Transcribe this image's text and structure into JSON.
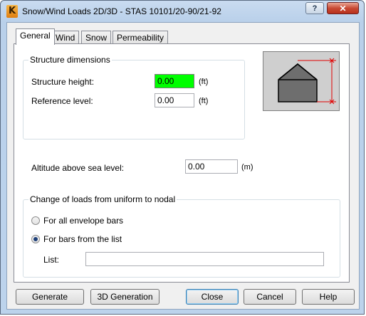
{
  "window": {
    "title": "Snow/Wind Loads 2D/3D - STAS 10101/20-90/21-92",
    "app_icon_letter": "K",
    "help_label": "?",
    "close_label": "✕"
  },
  "tabs": [
    {
      "label": "General",
      "active": true
    },
    {
      "label": "Wind",
      "active": false
    },
    {
      "label": "Snow",
      "active": false
    },
    {
      "label": "Permeability",
      "active": false
    }
  ],
  "structure_dimensions": {
    "group_label": "Structure dimensions",
    "height_label": "Structure height:",
    "height_value": "0.00",
    "height_unit": "(ft)",
    "reference_label": "Reference level:",
    "reference_value": "0.00",
    "reference_unit": "(ft)"
  },
  "altitude": {
    "label": "Altitude above sea level:",
    "value": "0.00",
    "unit": "(m)"
  },
  "load_change": {
    "group_label": "Change of loads from uniform to nodal",
    "option_all_label": "For all envelope bars",
    "option_list_label": "For bars from the list",
    "selected": "list",
    "list_label": "List:",
    "list_value": ""
  },
  "buttons": {
    "generate": "Generate",
    "generation_3d": "3D Generation",
    "close": "Close",
    "cancel": "Cancel",
    "help": "Help"
  },
  "colors": {
    "highlight_field": "#00ff00",
    "dimension_marker": "#e00000"
  }
}
